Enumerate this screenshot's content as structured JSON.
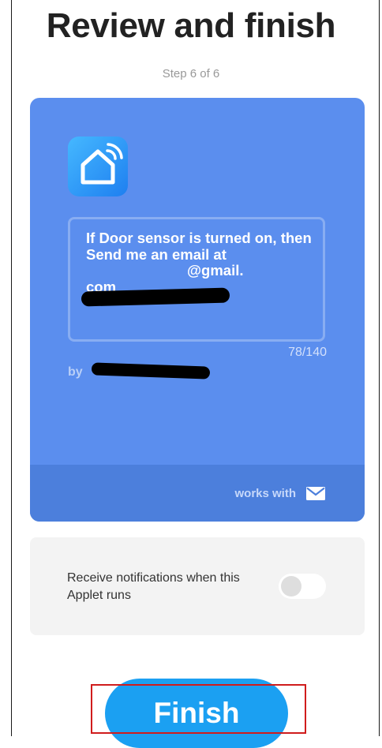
{
  "header": {
    "title": "Review and finish",
    "step": "Step 6 of 6"
  },
  "applet": {
    "icon": "smart-home-icon",
    "text_line1": "If Door sensor is turned on, then Send me an email at",
    "text_email_domain": "@gmail.",
    "text_email_tld": "com",
    "char_count": "78/140",
    "by_prefix": "by",
    "works_with_label": "works with",
    "works_with_icon": "mail-icon",
    "card_color": "#5b8eee",
    "footer_color": "#4c7fdc"
  },
  "notifications": {
    "label": "Receive notifications when this Applet runs",
    "enabled": false
  },
  "actions": {
    "finish_label": "Finish",
    "finish_color": "#1ba0f2"
  }
}
